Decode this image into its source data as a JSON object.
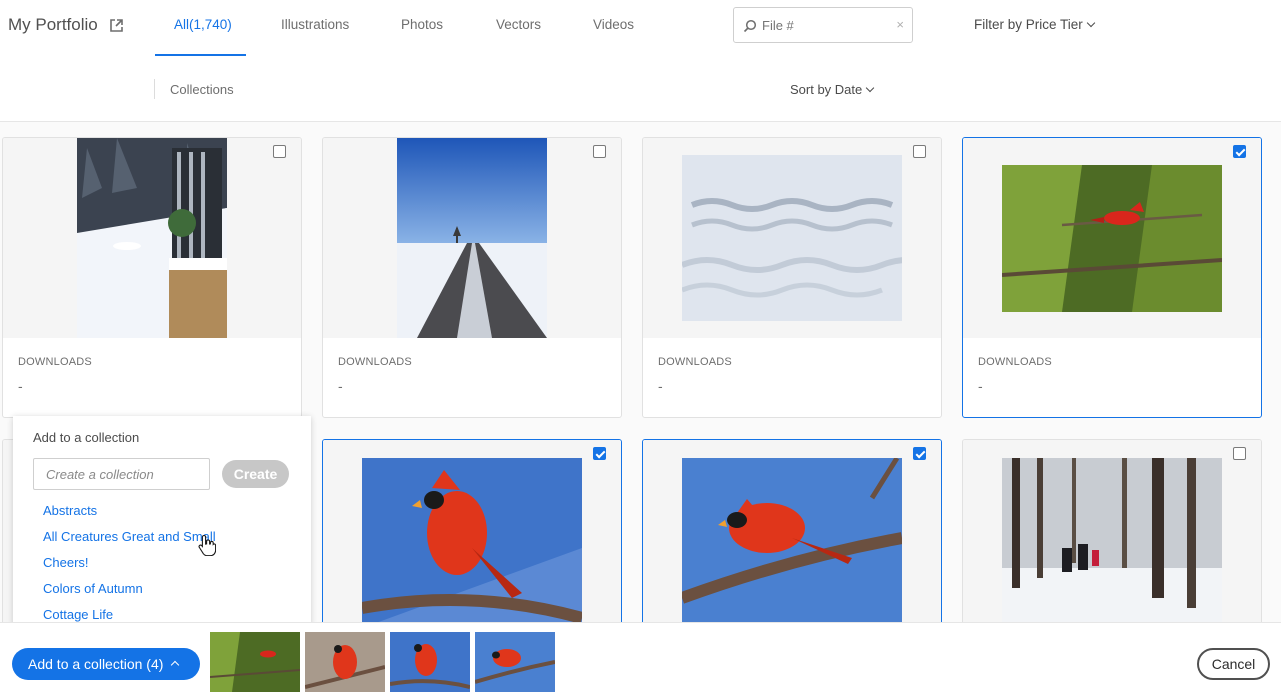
{
  "header": {
    "portfolio_title": "My Portfolio",
    "tabs": [
      {
        "label": "All(1,740)",
        "active": true
      },
      {
        "label": "Illustrations",
        "active": false
      },
      {
        "label": "Photos",
        "active": false
      },
      {
        "label": "Vectors",
        "active": false
      },
      {
        "label": "Videos",
        "active": false
      }
    ],
    "search": {
      "placeholder": "File #",
      "icon": "search-icon",
      "clear_glyph": "×"
    },
    "filter_label": "Filter by Price Tier"
  },
  "subbar": {
    "collections_label": "Collections",
    "sort_label": "Sort by Date"
  },
  "assets": [
    {
      "subject": "snowy porch",
      "downloads_label": "DOWNLOADS",
      "downloads_value": "-",
      "checked": false
    },
    {
      "subject": "snowy road",
      "downloads_label": "DOWNLOADS",
      "downloads_value": "-",
      "checked": false
    },
    {
      "subject": "tire tracks in snow",
      "downloads_label": "DOWNLOADS",
      "downloads_value": "-",
      "checked": false
    },
    {
      "subject": "cardinal in evergreen",
      "downloads_label": "DOWNLOADS",
      "downloads_value": "-",
      "checked": true
    },
    {
      "subject": "cardinal on branch",
      "checked": true
    },
    {
      "subject": "cardinal on branch 2",
      "checked": true
    },
    {
      "subject": "winter forest walk",
      "checked": false
    }
  ],
  "collection_popup": {
    "title": "Add to a collection",
    "input_placeholder": "Create a collection",
    "create_label": "Create",
    "collections": [
      "Abstracts",
      "All Creatures Great and Small",
      "Cheers!",
      "Colors of Autumn",
      "Cottage Life"
    ]
  },
  "bottom_bar": {
    "add_button_label": "Add to a collection (4)",
    "cancel_label": "Cancel"
  },
  "colors": {
    "accent": "#1473e6",
    "disabled_button": "#c7c7c7"
  }
}
